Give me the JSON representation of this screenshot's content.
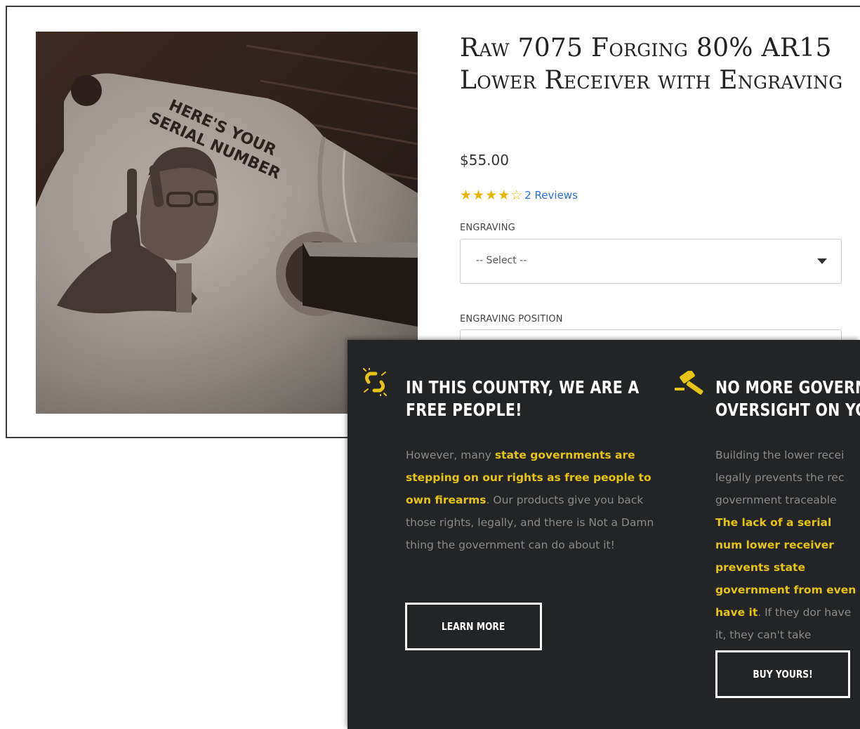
{
  "product": {
    "title": "Raw 7075 Forging 80% AR15 Lower Receiver with Engraving",
    "price": "$55.00",
    "rating": {
      "value": 4,
      "max": 5
    },
    "reviews_label": "2 Reviews",
    "image_text": [
      "HERE'S YOUR",
      "SERIAL NUMBER"
    ],
    "engraving_label": "ENGRAVING",
    "engraving_select": "-- Select --",
    "position_label": "ENGRAVING POSITION"
  },
  "features": [
    {
      "icon": "broken-chain-icon",
      "heading_lines": [
        "IN THIS COUNTRY, WE ARE A",
        "FREE PEOPLE!"
      ],
      "text": [
        {
          "t": "However, many ",
          "hl": false
        },
        {
          "t": "state governments are stepping on our rights as free people to own firearms",
          "hl": true
        },
        {
          "t": ". Our products give you back those rights, legally, and there is Not a Damn thing the government can do about it!",
          "hl": false
        }
      ],
      "button": "LEARN MORE"
    },
    {
      "icon": "gavel-icon",
      "heading_lines": [
        "NO MORE GOVERNI",
        "OVERSIGHT ON YO"
      ],
      "text": [
        {
          "t": "Building the lower recei legally prevents the rec government traceable ",
          "hl": false
        },
        {
          "t": "The lack of a serial num lower receiver prevents state government from even have it",
          "hl": true
        },
        {
          "t": ". If they dor have it, they can't take",
          "hl": false
        }
      ],
      "button": "BUY YOURS!"
    }
  ],
  "colors": {
    "panel_bg": "#232425",
    "highlight": "#e6c417",
    "star": "#e8b400",
    "link": "#2a6fd6"
  }
}
